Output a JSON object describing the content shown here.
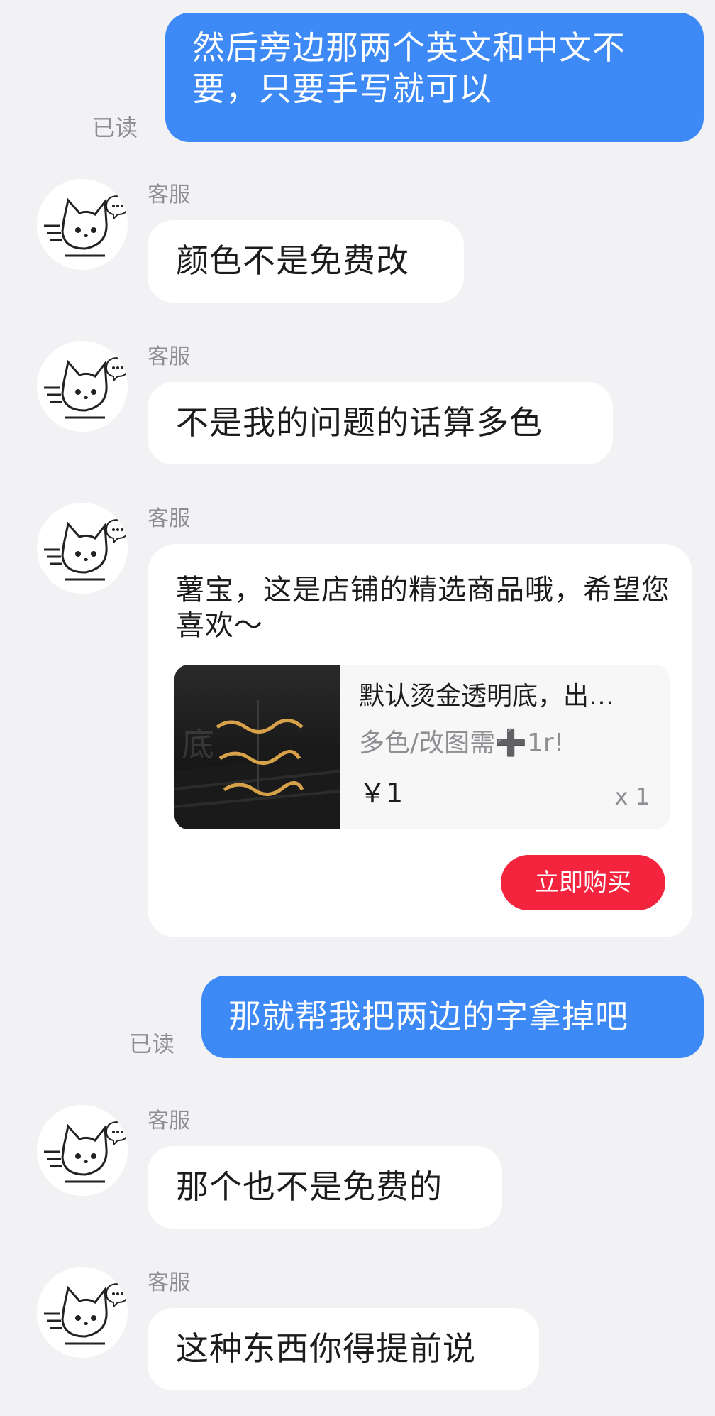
{
  "read_label": "已读",
  "agent_name": "客服",
  "messages": [
    {
      "text": "然后旁边那两个英文和中文不要，只要手写就可以"
    },
    {
      "text": "颜色不是免费改"
    },
    {
      "text": "不是我的问题的话算多色"
    },
    {
      "text": "那就帮我把两边的字拿掉吧"
    },
    {
      "text": "那个也不是免费的"
    },
    {
      "text": "这种东西你得提前说"
    }
  ],
  "product_card": {
    "message": "薯宝，这是店铺的精选商品哦，希望您喜欢～",
    "title": "默认烫金透明底，出…",
    "subtitle": "多色/改图需➕1r!",
    "price": "￥1",
    "quantity": "x 1",
    "buy_label": "立即购买"
  },
  "colors": {
    "outgoing_bubble": "#3d8af7",
    "incoming_bubble": "#ffffff",
    "background": "#f2f2f4",
    "buy_button": "#f4243f",
    "secondary_text": "#8e8e93"
  },
  "icons": {
    "avatar": "white-cat-avatar-icon",
    "plus": "heavy-plus-sign"
  }
}
